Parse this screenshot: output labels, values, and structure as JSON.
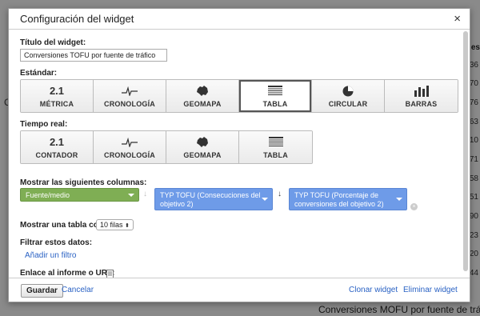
{
  "background": {
    "left_text": "C",
    "header_text": "es",
    "numbers": [
      "36",
      "70",
      "76",
      "63",
      "10",
      "71",
      "58",
      "51",
      "90",
      "23",
      "20",
      "44"
    ],
    "footer_text": "Conversiones MOFU por fuente de tráfico"
  },
  "dialog": {
    "title": "Configuración del widget",
    "close_label": "×"
  },
  "widget_title": {
    "label": "Título del widget:",
    "value": "Conversiones TOFU por fuente de tráfico"
  },
  "standard": {
    "label": "Estándar:",
    "types": [
      {
        "label": "MÉTRICA",
        "icon": "2.1",
        "icon_name": "metric-icon"
      },
      {
        "label": "CRONOLOGÍA",
        "icon": "timeline",
        "icon_name": "timeline-icon"
      },
      {
        "label": "GEOMAPA",
        "icon": "map",
        "icon_name": "map-icon"
      },
      {
        "label": "TABLA",
        "icon": "table",
        "icon_name": "table-icon",
        "selected": true
      },
      {
        "label": "CIRCULAR",
        "icon": "pie",
        "icon_name": "pie-chart-icon"
      },
      {
        "label": "BARRAS",
        "icon": "bars",
        "icon_name": "bar-chart-icon"
      }
    ]
  },
  "realtime": {
    "label": "Tiempo real:",
    "types": [
      {
        "label": "CONTADOR",
        "icon": "2.1",
        "icon_name": "counter-icon"
      },
      {
        "label": "CRONOLOGÍA",
        "icon": "timeline",
        "icon_name": "timeline-icon"
      },
      {
        "label": "GEOMAPA",
        "icon": "map",
        "icon_name": "map-icon"
      },
      {
        "label": "TABLA",
        "icon": "table",
        "icon_name": "table-icon"
      }
    ]
  },
  "columns": {
    "label": "Mostrar las siguientes columnas:",
    "dimension": "Fuente/medio",
    "metric1": "TYP TOFU (Consecuciones del objetivo 2)",
    "metric2": "TYP TOFU (Porcentaje de conversiones del objetivo 2)",
    "arrow": "↓"
  },
  "table_rows": {
    "label": "Mostrar una tabla con",
    "value": "10 filas"
  },
  "filter": {
    "label": "Filtrar estos datos:",
    "link": "Añadir un filtro"
  },
  "link_url": {
    "label": "Enlace al informe o URL:"
  },
  "footer": {
    "save": "Guardar",
    "cancel": "Cancelar",
    "clone": "Clonar widget",
    "delete": "Eliminar widget"
  },
  "colors": {
    "dimension_chip": "#7fae54",
    "metric_chip": "#6e9be8",
    "link": "#2a62c4"
  }
}
